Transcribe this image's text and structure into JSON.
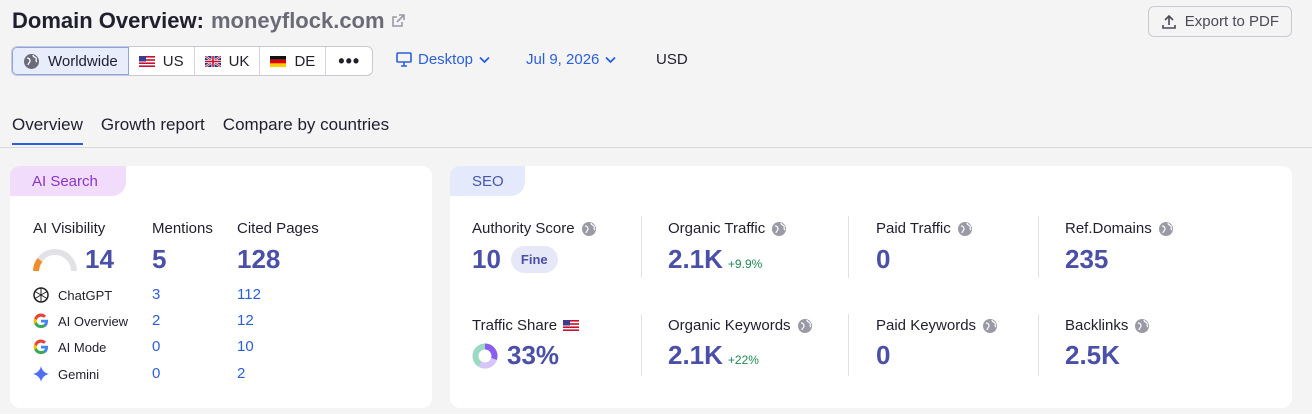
{
  "header": {
    "title": "Domain Overview:",
    "domain": "moneyflock.com",
    "export_label": "Export to PDF"
  },
  "databases": [
    {
      "label": "Worldwide"
    },
    {
      "label": "US"
    },
    {
      "label": "UK"
    },
    {
      "label": "DE"
    },
    {
      "label": "•••"
    }
  ],
  "filters": {
    "device": "Desktop",
    "date": "Jul 9, 2026",
    "currency": "USD"
  },
  "tabs": [
    "Overview",
    "Growth report",
    "Compare by countries"
  ],
  "ai_search": {
    "tag": "AI Search",
    "visibility_label": "AI Visibility",
    "visibility_value": "14",
    "mentions_label": "Mentions",
    "mentions_value": "5",
    "cited_label": "Cited Pages",
    "cited_value": "128",
    "rows": [
      {
        "name": "ChatGPT",
        "mentions": "3",
        "cited": "112"
      },
      {
        "name": "AI Overview",
        "mentions": "2",
        "cited": "12"
      },
      {
        "name": "AI Mode",
        "mentions": "0",
        "cited": "10"
      },
      {
        "name": "Gemini",
        "mentions": "0",
        "cited": "2"
      }
    ]
  },
  "seo": {
    "tag": "SEO",
    "authority_label": "Authority Score",
    "authority_value": "10",
    "authority_badge": "Fine",
    "organic_traffic_label": "Organic Traffic",
    "organic_traffic_value": "2.1K",
    "organic_traffic_delta": "+9.9%",
    "paid_traffic_label": "Paid Traffic",
    "paid_traffic_value": "0",
    "ref_domains_label": "Ref.Domains",
    "ref_domains_value": "235",
    "traffic_share_label": "Traffic Share",
    "traffic_share_value": "33%",
    "organic_keywords_label": "Organic Keywords",
    "organic_keywords_value": "2.1K",
    "organic_keywords_delta": "+22%",
    "paid_keywords_label": "Paid Keywords",
    "paid_keywords_value": "0",
    "backlinks_label": "Backlinks",
    "backlinks_value": "2.5K"
  },
  "colors": {
    "accent": "#2b5fd9",
    "metric": "#4a4fa8",
    "ai_tag": "#f1dcfb",
    "seo_tag": "#e4e9fb",
    "positive": "#1e8a52"
  }
}
